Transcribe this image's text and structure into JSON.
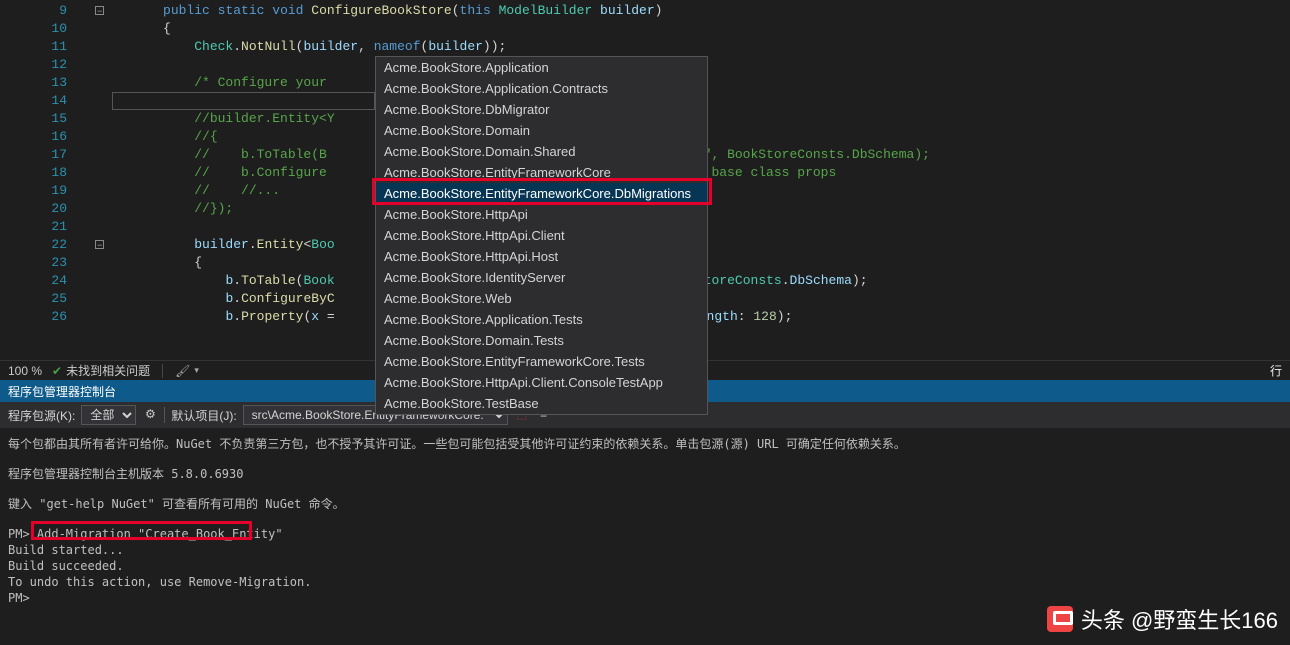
{
  "code": {
    "line_numbers": [
      "9",
      "10",
      "11",
      "12",
      "13",
      "14",
      "15",
      "16",
      "17",
      "18",
      "19",
      "20",
      "21",
      "22",
      "23",
      "24",
      "25",
      "26"
    ],
    "lines": {
      "9": {
        "indent": "          ",
        "tokens": [
          {
            "t": "public",
            "c": "kw"
          },
          {
            "t": " "
          },
          {
            "t": "static",
            "c": "kw"
          },
          {
            "t": " "
          },
          {
            "t": "void",
            "c": "kw"
          },
          {
            "t": " "
          },
          {
            "t": "ConfigureBookStore",
            "c": "fn"
          },
          {
            "t": "(",
            "c": "op"
          },
          {
            "t": "this",
            "c": "kw"
          },
          {
            "t": " "
          },
          {
            "t": "ModelBuilder",
            "c": "cls"
          },
          {
            "t": " "
          },
          {
            "t": "builder",
            "c": "prm"
          },
          {
            "t": ")",
            "c": "op"
          }
        ]
      },
      "10": {
        "indent": "          ",
        "tokens": [
          {
            "t": "{",
            "c": "op"
          }
        ]
      },
      "11": {
        "indent": "              ",
        "tokens": [
          {
            "t": "Check",
            "c": "cls"
          },
          {
            "t": ".",
            "c": "op"
          },
          {
            "t": "NotNull",
            "c": "fn"
          },
          {
            "t": "(",
            "c": "op"
          },
          {
            "t": "builder",
            "c": "prm"
          },
          {
            "t": ", ",
            "c": "op"
          },
          {
            "t": "nameof",
            "c": "kw"
          },
          {
            "t": "(",
            "c": "op"
          },
          {
            "t": "builder",
            "c": "prm"
          },
          {
            "t": "));",
            "c": "op"
          }
        ]
      },
      "12": {
        "indent": "",
        "tokens": []
      },
      "13": {
        "indent": "              ",
        "tokens": [
          {
            "t": "/* Configure your",
            "c": "cmt"
          }
        ]
      },
      "14": {
        "indent": "",
        "tokens": []
      },
      "15": {
        "indent": "              ",
        "tokens": [
          {
            "t": "//builder.Entity<Y",
            "c": "cmt"
          }
        ]
      },
      "16": {
        "indent": "              ",
        "tokens": [
          {
            "t": "//{",
            "c": "cmt"
          }
        ]
      },
      "17": {
        "indent": "              ",
        "tokens": [
          {
            "t": "//    b.ToTable(B",
            "c": "cmt"
          }
        ]
      },
      "17b": {
        "trail": [
          {
            "t": "tities\", ",
            "c": "cmt"
          },
          {
            "t": "BookStoreConsts",
            "c": "cmt"
          },
          {
            "t": ".",
            "c": "cmt"
          },
          {
            "t": "DbSchema",
            "c": "cmt"
          },
          {
            "t": ");",
            "c": "cmt"
          }
        ]
      },
      "18": {
        "indent": "              ",
        "tokens": [
          {
            "t": "//    b.Configure",
            "c": "cmt"
          }
        ]
      },
      "18b": {
        "trail": [
          {
            "t": " the   ",
            "c": "cmt"
          },
          {
            "t": "base class props",
            "c": "cmt"
          }
        ]
      },
      "19": {
        "indent": "              ",
        "tokens": [
          {
            "t": "//    //...",
            "c": "cmt"
          }
        ]
      },
      "20": {
        "indent": "              ",
        "tokens": [
          {
            "t": "//});",
            "c": "cmt"
          }
        ]
      },
      "21": {
        "indent": "",
        "tokens": []
      },
      "22": {
        "indent": "              ",
        "tokens": [
          {
            "t": "builder",
            "c": "prm"
          },
          {
            "t": ".",
            "c": "op"
          },
          {
            "t": "Entity",
            "c": "fn"
          },
          {
            "t": "<",
            "c": "op"
          },
          {
            "t": "Boo",
            "c": "cls"
          }
        ]
      },
      "23": {
        "indent": "              ",
        "tokens": [
          {
            "t": "{",
            "c": "op"
          }
        ]
      },
      "24": {
        "indent": "                  ",
        "tokens": [
          {
            "t": "b",
            "c": "prm"
          },
          {
            "t": ".",
            "c": "op"
          },
          {
            "t": "ToTable",
            "c": "fn"
          },
          {
            "t": "(",
            "c": "op"
          },
          {
            "t": "Book",
            "c": "cls"
          }
        ]
      },
      "24b": {
        "trail": [
          {
            "t": "BookStoreConsts",
            "c": "cls"
          },
          {
            "t": ".",
            "c": "op"
          },
          {
            "t": "DbSchema",
            "c": "prm"
          },
          {
            "t": ");",
            "c": "op"
          }
        ]
      },
      "25": {
        "indent": "                  ",
        "tokens": [
          {
            "t": "b",
            "c": "prm"
          },
          {
            "t": ".",
            "c": "op"
          },
          {
            "t": "ConfigureByC",
            "c": "fn"
          }
        ]
      },
      "26": {
        "indent": "                  ",
        "tokens": [
          {
            "t": "b",
            "c": "prm"
          },
          {
            "t": ".",
            "c": "op"
          },
          {
            "t": "Property",
            "c": "fn"
          },
          {
            "t": "(",
            "c": "op"
          },
          {
            "t": "x ",
            "c": "prm"
          },
          {
            "t": "=",
            "c": "op"
          }
        ]
      },
      "26b": {
        "trail": [
          {
            "t": "(",
            "c": "op"
          },
          {
            "t": "maxLength",
            "c": "prm"
          },
          {
            "t": ": ",
            "c": "op"
          },
          {
            "t": "128",
            "c": "num"
          },
          {
            "t": ");",
            "c": "op"
          }
        ]
      }
    }
  },
  "dropdown": {
    "items": [
      "Acme.BookStore.Application",
      "Acme.BookStore.Application.Contracts",
      "Acme.BookStore.DbMigrator",
      "Acme.BookStore.Domain",
      "Acme.BookStore.Domain.Shared",
      "Acme.BookStore.EntityFrameworkCore",
      "Acme.BookStore.EntityFrameworkCore.DbMigrations",
      "Acme.BookStore.HttpApi",
      "Acme.BookStore.HttpApi.Client",
      "Acme.BookStore.HttpApi.Host",
      "Acme.BookStore.IdentityServer",
      "Acme.BookStore.Web",
      "Acme.BookStore.Application.Tests",
      "Acme.BookStore.Domain.Tests",
      "Acme.BookStore.EntityFrameworkCore.Tests",
      "Acme.BookStore.HttpApi.Client.ConsoleTestApp",
      "Acme.BookStore.TestBase"
    ],
    "selected_index": 6
  },
  "status": {
    "zoom": "100 %",
    "issues": "未找到相关问题",
    "right": "行"
  },
  "pmc": {
    "title": "程序包管理器控制台",
    "toolbar": {
      "source_label": "程序包源(K):",
      "source_value": "全部",
      "default_project_label": "默认项目(J):",
      "default_project_value": "src\\Acme.BookStore.EntityFrameworkCore."
    },
    "output": {
      "line1": "每个包都由其所有者许可给你。NuGet 不负责第三方包，也不授予其许可证。一些包可能包括受其他许可证约束的依赖关系。单击包源(源) URL 可确定任何依赖关系。",
      "line2": "程序包管理器控制台主机版本 5.8.0.6930",
      "line3": "键入 \"get-help NuGet\" 可查看所有可用的 NuGet 命令。",
      "prompt1": "PM> ",
      "cmd1": "Add-Migration \"Create_Book_Entity\"",
      "build1": "Build started...",
      "build2": "Build succeeded.",
      "undo": "To undo this action, use Remove-Migration.",
      "prompt2": "PM>"
    }
  },
  "watermark": "头条 @野蛮生长166"
}
